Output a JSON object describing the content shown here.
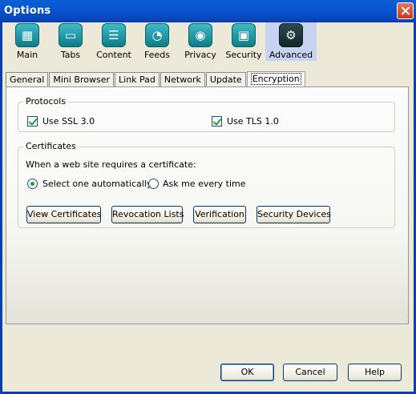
{
  "window": {
    "title": "Options"
  },
  "toolbar": {
    "items": [
      {
        "label": "Main",
        "icon": "main-icon"
      },
      {
        "label": "Tabs",
        "icon": "tabs-icon"
      },
      {
        "label": "Content",
        "icon": "content-icon"
      },
      {
        "label": "Feeds",
        "icon": "feeds-icon"
      },
      {
        "label": "Privacy",
        "icon": "privacy-icon"
      },
      {
        "label": "Security",
        "icon": "security-icon"
      },
      {
        "label": "Advanced",
        "icon": "gear-icon",
        "selected": true
      }
    ]
  },
  "tabs": [
    {
      "label": "General"
    },
    {
      "label": "Mini Browser"
    },
    {
      "label": "Link Pad"
    },
    {
      "label": "Network"
    },
    {
      "label": "Update"
    },
    {
      "label": "Encryption",
      "selected": true
    }
  ],
  "protocols": {
    "legend": "Protocols",
    "ssl3": {
      "label": "Use SSL 3.0",
      "checked": true
    },
    "tls1": {
      "label": "Use TLS 1.0",
      "checked": true
    }
  },
  "certificates": {
    "legend": "Certificates",
    "prompt": "When a web site requires a certificate:",
    "option_auto": {
      "label": "Select one automatically",
      "selected": true
    },
    "option_ask": {
      "label": "Ask me every time",
      "selected": false
    },
    "buttons": {
      "view": "View Certificates",
      "revocation": "Revocation Lists",
      "verification": "Verification",
      "devices": "Security Devices"
    }
  },
  "footer": {
    "ok": "OK",
    "cancel": "Cancel",
    "help": "Help"
  },
  "colors": {
    "titlebar": "#0a5fd6",
    "accent": "#21a121",
    "icon_teal": "#1a9aa6"
  }
}
